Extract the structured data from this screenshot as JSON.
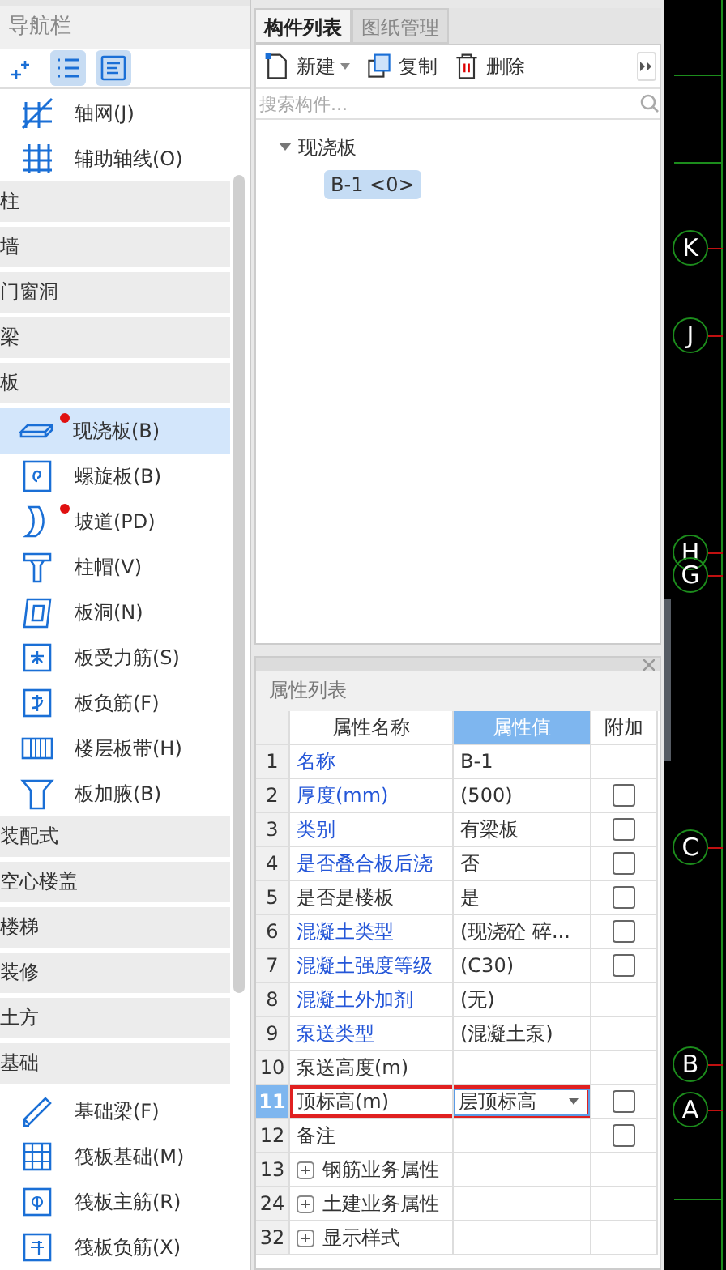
{
  "nav": {
    "title": "导航栏",
    "tools": [
      {
        "selected": false
      },
      {
        "selected": true
      },
      {
        "selected": true
      }
    ],
    "items": [
      {
        "kind": "item",
        "label": "轴网(J)",
        "selected": false,
        "modified": false
      },
      {
        "kind": "item",
        "label": "辅助轴线(O)",
        "selected": false,
        "modified": false
      },
      {
        "kind": "category",
        "label": "柱"
      },
      {
        "kind": "category",
        "label": "墙"
      },
      {
        "kind": "category",
        "label": "门窗洞"
      },
      {
        "kind": "category",
        "label": "梁"
      },
      {
        "kind": "category",
        "label": "板"
      },
      {
        "kind": "item",
        "label": "现浇板(B)",
        "selected": true,
        "modified": true
      },
      {
        "kind": "item",
        "label": "螺旋板(B)",
        "selected": false,
        "modified": false
      },
      {
        "kind": "item",
        "label": "坡道(PD)",
        "selected": false,
        "modified": true
      },
      {
        "kind": "item",
        "label": "柱帽(V)",
        "selected": false,
        "modified": false
      },
      {
        "kind": "item",
        "label": "板洞(N)",
        "selected": false,
        "modified": false
      },
      {
        "kind": "item",
        "label": "板受力筋(S)",
        "selected": false,
        "modified": false
      },
      {
        "kind": "item",
        "label": "板负筋(F)",
        "selected": false,
        "modified": false
      },
      {
        "kind": "item",
        "label": "楼层板带(H)",
        "selected": false,
        "modified": false
      },
      {
        "kind": "item",
        "label": "板加腋(B)",
        "selected": false,
        "modified": false
      },
      {
        "kind": "category",
        "label": "装配式"
      },
      {
        "kind": "category",
        "label": "空心楼盖"
      },
      {
        "kind": "category",
        "label": "楼梯"
      },
      {
        "kind": "category",
        "label": "装修"
      },
      {
        "kind": "category",
        "label": "土方"
      },
      {
        "kind": "category",
        "label": "基础"
      },
      {
        "kind": "item",
        "label": "基础梁(F)",
        "selected": false,
        "modified": false
      },
      {
        "kind": "item",
        "label": "筏板基础(M)",
        "selected": false,
        "modified": false
      },
      {
        "kind": "item",
        "label": "筏板主筋(R)",
        "selected": false,
        "modified": false
      },
      {
        "kind": "item",
        "label": "筏板负筋(X)",
        "selected": false,
        "modified": false
      }
    ]
  },
  "components": {
    "tabs": [
      {
        "label": "构件列表",
        "selected": true
      },
      {
        "label": "图纸管理",
        "selected": false
      }
    ],
    "toolbar": [
      {
        "kind": "new",
        "label": "新建"
      },
      {
        "kind": "copy",
        "label": "复制"
      },
      {
        "kind": "delete",
        "label": "删除"
      }
    ],
    "search": {
      "placeholder": "搜索构件..."
    },
    "tree": [
      {
        "label": "现浇板",
        "expanded": true,
        "children": [
          {
            "label": "B-1 <0>",
            "selected": true
          }
        ]
      }
    ]
  },
  "properties": {
    "title": "属性列表",
    "columns": [
      "属性名称",
      "属性值",
      "附加"
    ],
    "rows": [
      {
        "kind": "property",
        "index": "1",
        "name": "名称",
        "value": "B-1",
        "highlighted": true,
        "selected": false
      },
      {
        "kind": "property",
        "index": "2",
        "name": "厚度(mm)",
        "value": "(500)",
        "highlighted": true,
        "selected": false,
        "checkbox": {
          "checked": false
        }
      },
      {
        "kind": "property",
        "index": "3",
        "name": "类别",
        "value": "有梁板",
        "highlighted": true,
        "selected": false,
        "checkbox": {
          "checked": false
        }
      },
      {
        "kind": "property",
        "index": "4",
        "name": "是否叠合板后浇",
        "value": "否",
        "highlighted": true,
        "selected": false,
        "checkbox": {
          "checked": false
        }
      },
      {
        "kind": "property",
        "index": "5",
        "name": "是否是楼板",
        "value": "是",
        "highlighted": false,
        "selected": false,
        "checkbox": {
          "checked": false
        }
      },
      {
        "kind": "property",
        "index": "6",
        "name": "混凝土类型",
        "value": "(现浇砼 碎...",
        "highlighted": true,
        "selected": false,
        "checkbox": {
          "checked": false
        }
      },
      {
        "kind": "property",
        "index": "7",
        "name": "混凝土强度等级",
        "value": "(C30)",
        "highlighted": true,
        "selected": false,
        "checkbox": {
          "checked": false
        }
      },
      {
        "kind": "property",
        "index": "8",
        "name": "混凝土外加剂",
        "value": "(无)",
        "highlighted": true,
        "selected": false
      },
      {
        "kind": "property",
        "index": "9",
        "name": "泵送类型",
        "value": "(混凝土泵)",
        "highlighted": true,
        "selected": false
      },
      {
        "kind": "property",
        "index": "10",
        "name": "泵送高度(m)",
        "highlighted": false,
        "selected": false
      },
      {
        "kind": "property",
        "index": "11",
        "name": "顶标高(m)",
        "value": "层顶标高",
        "highlighted": false,
        "selected": true,
        "checkbox": {
          "checked": false
        }
      },
      {
        "kind": "property",
        "index": "12",
        "name": "备注",
        "highlighted": false,
        "selected": false,
        "checkbox": {
          "checked": false
        }
      },
      {
        "kind": "group",
        "index": "13",
        "name": "钢筋业务属性",
        "expanded": false
      },
      {
        "kind": "group",
        "index": "24",
        "name": "土建业务属性",
        "expanded": false
      },
      {
        "kind": "group",
        "index": "32",
        "name": "显示样式",
        "expanded": false
      }
    ]
  },
  "canvas": {
    "axes": [
      "K",
      "J",
      "H",
      "G",
      "C",
      "B",
      "A"
    ]
  }
}
